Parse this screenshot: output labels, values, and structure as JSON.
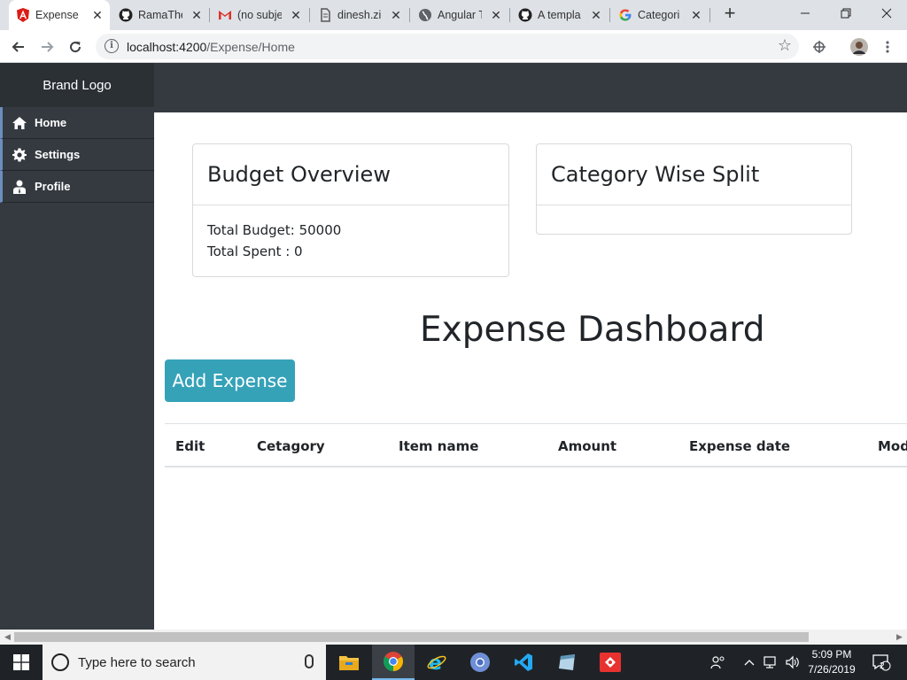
{
  "browser": {
    "tabs": [
      {
        "title": "Expense",
        "icon": "angular-icon"
      },
      {
        "title": "RamaThe",
        "icon": "github-icon"
      },
      {
        "title": "(no subje",
        "icon": "gmail-icon"
      },
      {
        "title": "dinesh.zi",
        "icon": "file-icon"
      },
      {
        "title": "Angular T",
        "icon": "globe-icon"
      },
      {
        "title": "A templa",
        "icon": "github-icon"
      },
      {
        "title": "Categori",
        "icon": "google-icon"
      }
    ],
    "url_host": "localhost:4200",
    "url_path": "/Expense/Home"
  },
  "sidebar": {
    "brand": "Brand Logo",
    "items": [
      {
        "label": "Home",
        "icon": "home-icon"
      },
      {
        "label": "Settings",
        "icon": "gear-icon"
      },
      {
        "label": "Profile",
        "icon": "user-icon"
      }
    ]
  },
  "budget_card": {
    "title": "Budget Overview",
    "total_budget": "Total Budget: 50000",
    "total_spent": "Total Spent : 0"
  },
  "category_card": {
    "title": "Category Wise Split"
  },
  "dashboard": {
    "title": "Expense Dashboard",
    "add_button": "Add Expense",
    "columns": [
      "Edit",
      "Cetagory",
      "Item name",
      "Amount",
      "Expense date",
      "Mod"
    ]
  },
  "taskbar": {
    "search_placeholder": "Type here to search",
    "time": "5:09 PM",
    "date": "7/26/2019",
    "notification_count": "2"
  },
  "colors": {
    "sidebar_bg": "#343a40",
    "brand_bg": "#2b3035",
    "button_bg": "#35a2b8",
    "accent": "#6c8ebf"
  }
}
